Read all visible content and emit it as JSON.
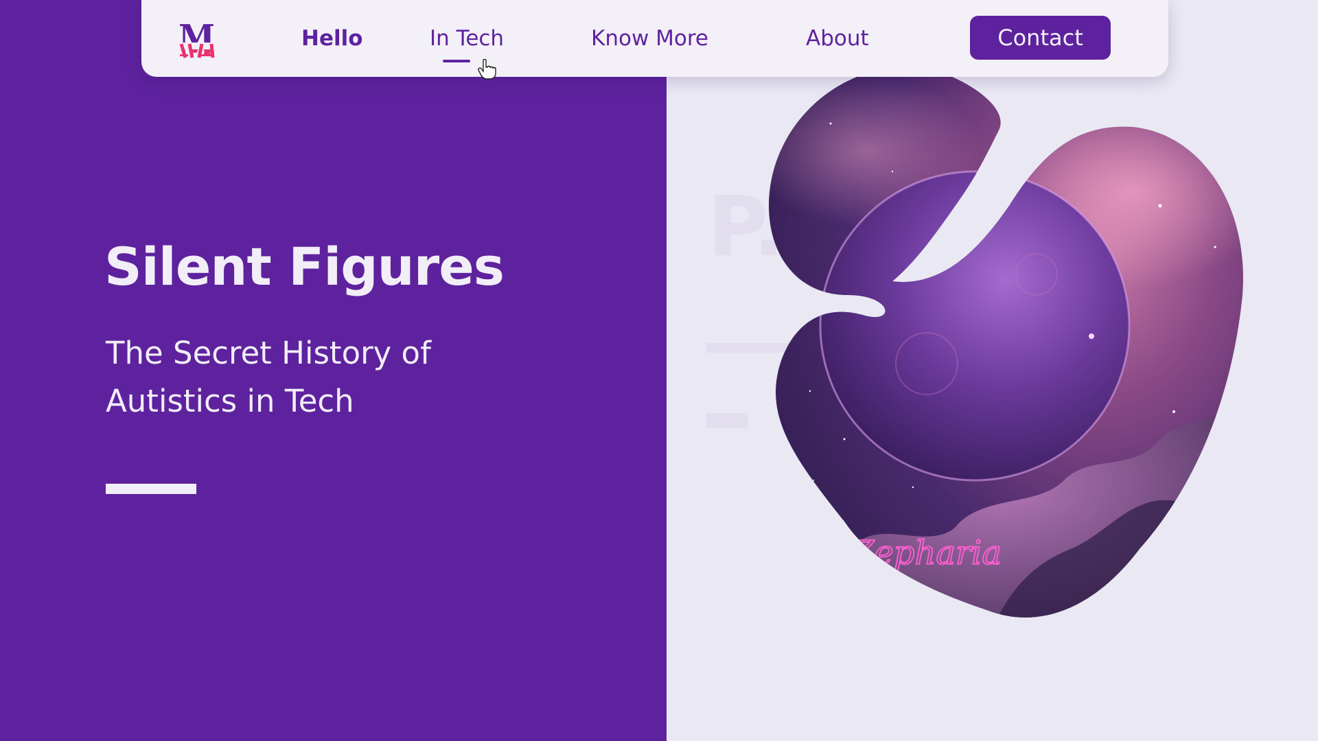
{
  "nav": {
    "logo_letter": "M",
    "items": [
      {
        "label": "Hello",
        "active": true
      },
      {
        "label": "In Tech",
        "active": false
      },
      {
        "label": "Know More",
        "active": false
      },
      {
        "label": "About",
        "active": false
      }
    ],
    "contact_label": "Contact"
  },
  "hero": {
    "title": "Silent Figures",
    "subtitle_line1": "The Secret History of",
    "subtitle_line2": "Autistics in Tech"
  },
  "artwork": {
    "neon_text": "Zepharia"
  },
  "background_ghost": {
    "text": "P..."
  },
  "colors": {
    "brand_purple": "#5e229e",
    "background_light": "#e9e8f3",
    "nav_background": "#f3f0f8",
    "logo_pink": "#e8336f",
    "neon_pink": "#ff5fd2"
  },
  "icons": {
    "logo": "m-monogram-logo",
    "cursor": "hand-pointer-cursor"
  }
}
